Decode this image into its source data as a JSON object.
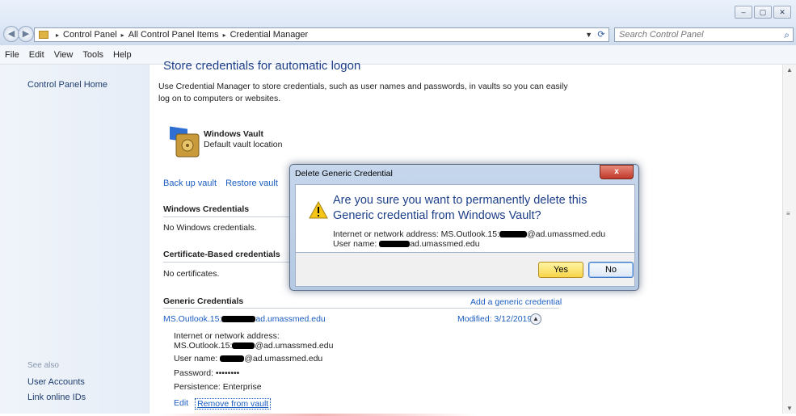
{
  "window": {
    "controls": {
      "minimize": "‒",
      "maximize": "▢",
      "close": "✕"
    }
  },
  "address": {
    "crumbs": [
      "Control Panel",
      "All Control Panel Items",
      "Credential Manager"
    ],
    "separator": "▸",
    "search_placeholder": "Search Control Panel"
  },
  "menu": [
    "File",
    "Edit",
    "View",
    "Tools",
    "Help"
  ],
  "sidebar": {
    "home": "Control Panel Home",
    "see_also": "See also",
    "links": [
      "User Accounts",
      "Link online IDs"
    ]
  },
  "main": {
    "heading": "Store credentials for automatic logon",
    "intro": "Use Credential Manager to store credentials, such as user names and passwords, in vaults so you can easily log on to computers or websites.",
    "vault_name": "Windows Vault",
    "vault_sub": "Default vault location",
    "backup": "Back up vault",
    "restore": "Restore vault",
    "windows_title": "Windows Credentials",
    "windows_empty": "No Windows credentials.",
    "cert_title": "Certificate-Based credentials",
    "cert_empty": "No certificates.",
    "generic_title": "Generic Credentials",
    "add_generic": "Add a generic credential",
    "cred_prefix": "MS.Outlook.15:",
    "cred_suffix": "ad.umassmed.edu",
    "modified": "Modified:  3/12/2019",
    "detail_addr_label": "Internet or network address:",
    "detail_addr_prefix": "MS.Outlook.15:",
    "detail_addr_suffix": "@ad.umassmed.edu",
    "detail_user_label": "User name:",
    "detail_user_suffix": "@ad.umassmed.edu",
    "detail_password": "Password:  ••••••••",
    "detail_persistence": "Persistence:  Enterprise",
    "edit": "Edit",
    "remove": "Remove from vault"
  },
  "dialog": {
    "title": "Delete Generic Credential",
    "close": "x",
    "question": "Are you sure you want to permanently delete this Generic credential from Windows Vault?",
    "addr_label": "Internet or network address: MS.Outlook.15:",
    "addr_suffix": "@ad.umassmed.edu",
    "user_label": "User name:",
    "user_suffix": "ad.umassmed.edu",
    "yes": "Yes",
    "no": "No"
  },
  "colors": {
    "link": "#1a5dc0",
    "heading": "#1d3f8a",
    "yes_button": "#f7d54a"
  }
}
